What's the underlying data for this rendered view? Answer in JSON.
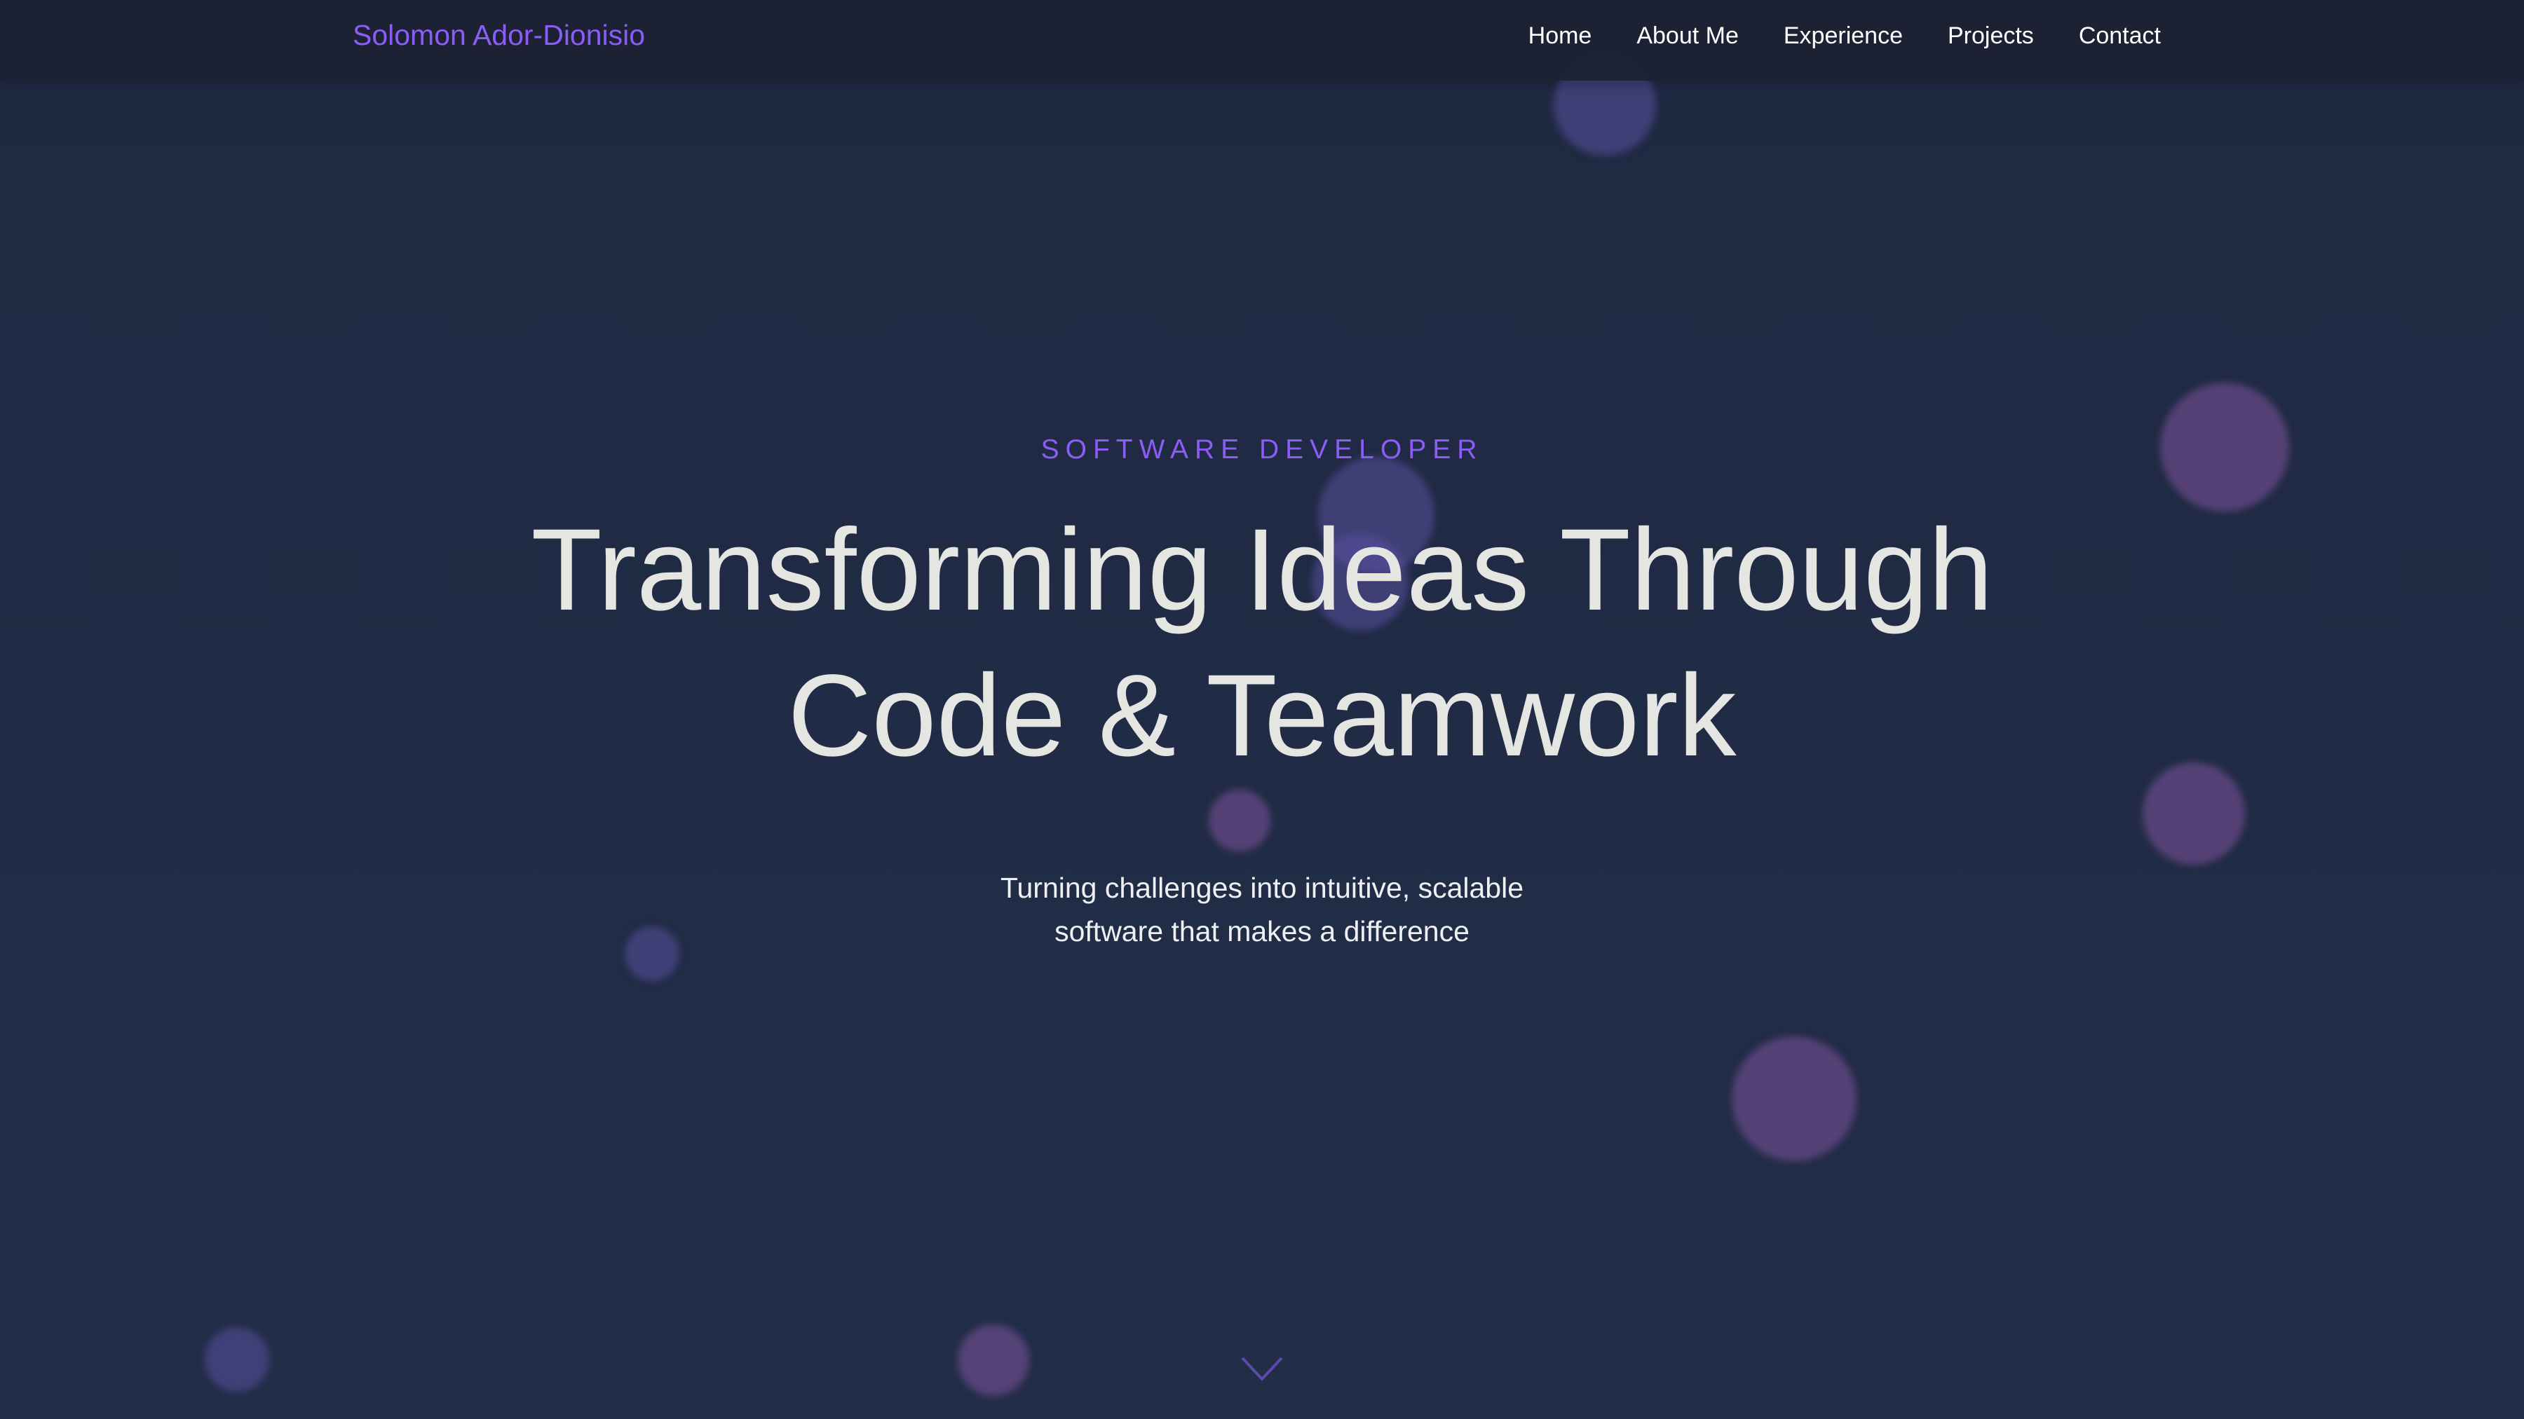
{
  "nav": {
    "logo": "Solomon Ador-Dionisio",
    "links": [
      "Home",
      "About Me",
      "Experience",
      "Projects",
      "Contact"
    ]
  },
  "hero": {
    "eyebrow": "SOFTWARE DEVELOPER",
    "headline_line1": "Transforming Ideas Through",
    "headline_line2": "Code & Teamwork",
    "tagline_line1": "Turning challenges into intuitive, scalable",
    "tagline_line2": "software that makes a difference"
  },
  "icons": {
    "scroll": "chevron-down-icon"
  },
  "colors": {
    "accent": "#8b5cf6",
    "background": "#222d48",
    "nav": "#1c2234",
    "headline": "#e5e5e2"
  }
}
